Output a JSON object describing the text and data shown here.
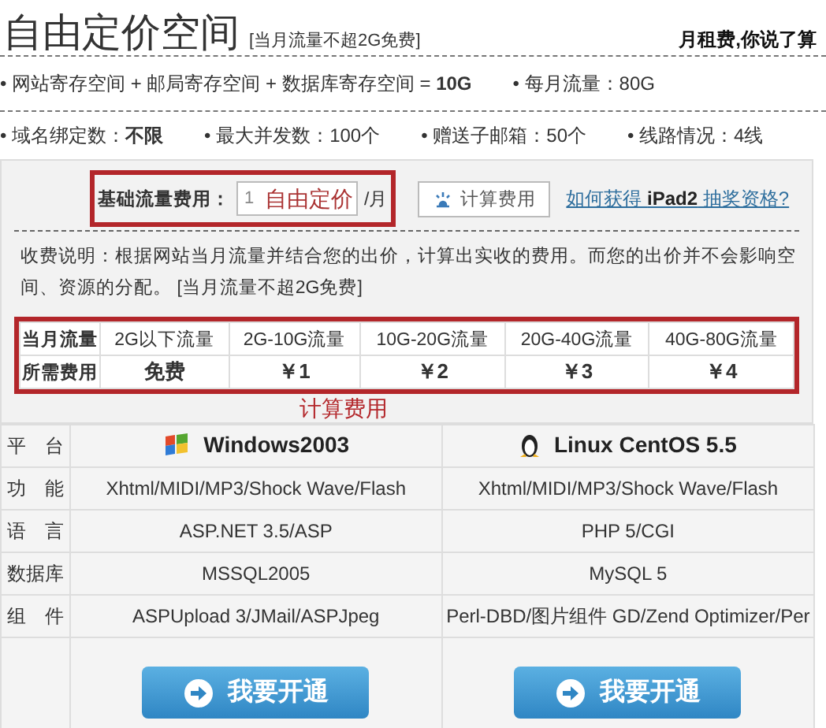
{
  "header": {
    "title": "自由定价空间",
    "note": "[当月流量不超2G免费]",
    "slogan": "月租费,你说了算"
  },
  "features": [
    [
      "• 网站寄存空间 + 邮局寄存空间 + 数据库寄存空间 = **10G**",
      "• 每月流量：80G"
    ],
    [
      "• 域名绑定数：**不限**",
      "• 最大并发数：100个",
      "• 赠送子邮箱：50个",
      "• 线路情况：4线"
    ]
  ],
  "pricing": {
    "label": "基础流量费用：",
    "input_value": "1",
    "unit": "/月",
    "input_annotation": "自由定价",
    "calc_button": "计算费用",
    "link_prefix": "如何获得",
    "link_bold": "iPad2",
    "link_suffix": "抽奖资格?"
  },
  "explanation": "收费说明：根据网站当月流量并结合您的出价，计算出实收的费用。而您的出价并不会影响空间、资源的分配。 [当月流量不超2G免费]",
  "fee_table": {
    "rows": [
      {
        "header": "当月流量",
        "cells": [
          "2G以下流量",
          "2G-10G流量",
          "10G-20G流量",
          "20G-40G流量",
          "40G-80G流量"
        ]
      },
      {
        "header": "所需费用",
        "cells": [
          "免费",
          "￥1",
          "￥2",
          "￥3",
          "￥4"
        ]
      }
    ]
  },
  "table_annotation": "计算费用",
  "platforms": {
    "columns": [
      {
        "os": "Windows2003",
        "kind": "windows"
      },
      {
        "os": "Linux CentOS 5.5",
        "kind": "linux"
      }
    ],
    "rows": [
      {
        "label": "平　台",
        "kind": "header"
      },
      {
        "label": "功　能",
        "values": [
          "Xhtml/MIDI/MP3/Shock Wave/Flash",
          "Xhtml/MIDI/MP3/Shock Wave/Flash"
        ]
      },
      {
        "label": "语　言",
        "values": [
          "ASP.NET 3.5/ASP",
          "PHP 5/CGI"
        ]
      },
      {
        "label": "数据库",
        "values": [
          "MSSQL2005",
          "MySQL 5"
        ]
      },
      {
        "label": "组　件",
        "values": [
          "ASPUpload 3/JMail/ASPJpeg",
          "Perl-DBD/图片组件  GD/Zend Optimizer/Per"
        ]
      }
    ],
    "buttons": [
      "我要开通",
      "我要开通"
    ]
  }
}
